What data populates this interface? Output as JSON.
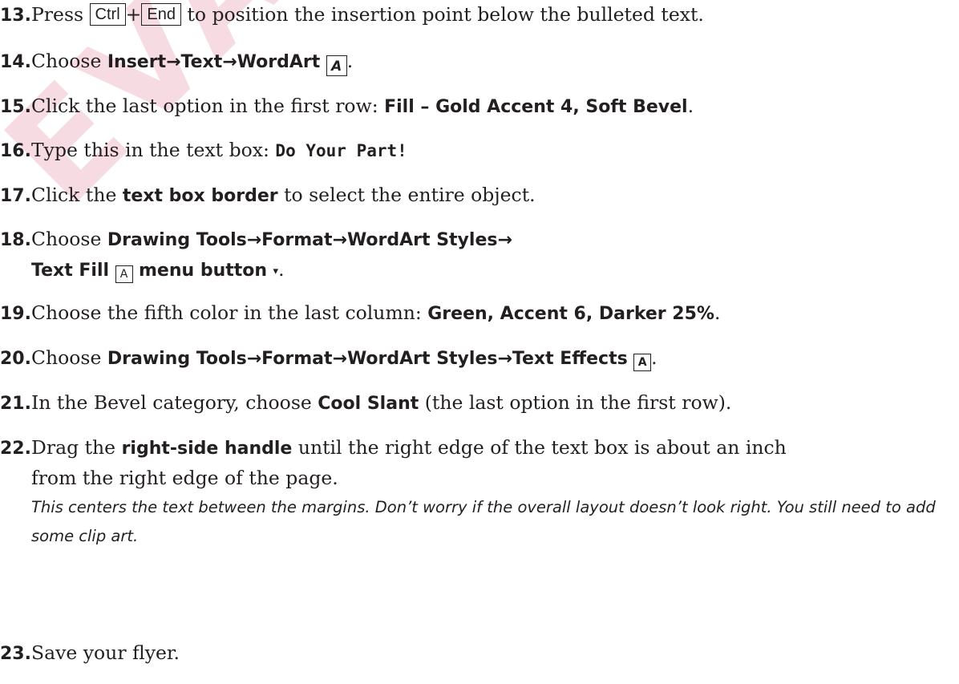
{
  "watermark": "EVALUATION",
  "steps": [
    {
      "num": "13.",
      "pre": "Press ",
      "key1": "Ctrl",
      "plus": "+",
      "key2": "End",
      "post": " to position the insertion point below the bulleted text."
    },
    {
      "num": "14.",
      "pre": "Choose ",
      "bold": "Insert→Text→WordArt",
      "post": "."
    },
    {
      "num": "15.",
      "pre": "Click the last option in the first row: ",
      "bold": "Fill – Gold Accent 4, Soft Bevel",
      "post": "."
    },
    {
      "num": "16.",
      "pre": "Type this in the text box: ",
      "code": "Do Your Part!"
    },
    {
      "num": "17.",
      "pre": "Click the ",
      "bold": "text box border",
      "post": " to select the entire object."
    },
    {
      "num": "18.",
      "pre": "Choose ",
      "bold": "Drawing Tools→Format→WordArt Styles→",
      "bold2": "Text Fill",
      "bold3": "menu button",
      "post": "."
    },
    {
      "num": "19.",
      "pre": "Choose the fifth color in the last column: ",
      "bold": "Green, Accent 6, Darker 25%",
      "post": "."
    },
    {
      "num": "20.",
      "pre": "Choose ",
      "bold": "Drawing Tools→Format→WordArt Styles→Text Effects",
      "post": "."
    },
    {
      "num": "21.",
      "pre": "In the Bevel category, choose ",
      "bold": "Cool Slant",
      "post": " (the last option in the first row)."
    },
    {
      "num": "22.",
      "pre": "Drag the ",
      "bold": "right-side handle",
      "post": " until the right edge of the text box is about an inch",
      "line2": "from the right edge of the page.",
      "note": "This centers the text between the margins. Don’t worry if the overall layout doesn’t look right. You still need to add some clip art."
    },
    {
      "num": "23.",
      "pre": "Save your flyer."
    }
  ],
  "icons": {
    "wordart": "wordart-icon",
    "text_fill": "text-fill-icon",
    "text_effects": "text-effects-icon",
    "dropdown": "dropdown-arrow-icon"
  }
}
